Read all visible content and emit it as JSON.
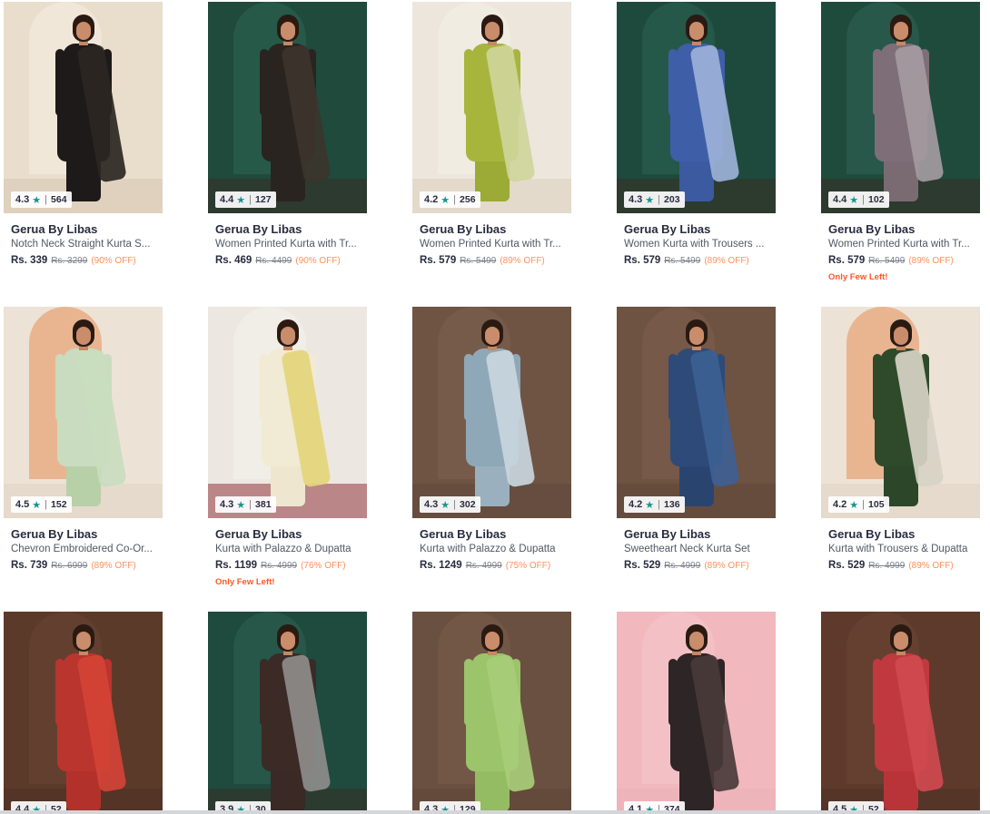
{
  "products": [
    {
      "brand": "Gerua By Libas",
      "title": "Notch Neck Straight Kurta S...",
      "price": "Rs. 339",
      "mrp": "Rs. 3299",
      "discount": "(90% OFF)",
      "rating": "4.3",
      "rating_count": "564",
      "few_left": "",
      "colors": {
        "bg": "#e9ddcc",
        "arch": "#f6efe3",
        "floor": "#d6c6ae",
        "outfit": "#1d1a19",
        "dupatta": "#2b2622",
        "legs": "#1d1a19"
      }
    },
    {
      "brand": "Gerua By Libas",
      "title": "Women Printed Kurta with Tr...",
      "price": "Rs. 469",
      "mrp": "Rs. 4499",
      "discount": "(90% OFF)",
      "rating": "4.4",
      "rating_count": "127",
      "few_left": "",
      "colors": {
        "bg": "#1f4a3c",
        "arch": "#2e6653",
        "floor": "#3a2a22",
        "outfit": "#2a2420",
        "dupatta": "#3c342c",
        "legs": "#2a2420"
      }
    },
    {
      "brand": "Gerua By Libas",
      "title": "Women Printed Kurta with Tr...",
      "price": "Rs. 579",
      "mrp": "Rs. 5499",
      "discount": "(89% OFF)",
      "rating": "4.2",
      "rating_count": "256",
      "few_left": "",
      "colors": {
        "bg": "#ece6dc",
        "arch": "#f4f0e8",
        "floor": "#d9cdb9",
        "outfit": "#a8b53c",
        "dupatta": "#cfd59a",
        "legs": "#9caa36"
      }
    },
    {
      "brand": "Gerua By Libas",
      "title": "Women Kurta with Trousers ...",
      "price": "Rs. 579",
      "mrp": "Rs. 5499",
      "discount": "(89% OFF)",
      "rating": "4.3",
      "rating_count": "203",
      "few_left": "",
      "colors": {
        "bg": "#1e4a3d",
        "arch": "#2c6452",
        "floor": "#3b2b22",
        "outfit": "#3f5ea8",
        "dupatta": "#9cb1d8",
        "legs": "#3b5aa0"
      }
    },
    {
      "brand": "Gerua By Libas",
      "title": "Women Printed Kurta with Tr...",
      "price": "Rs. 579",
      "mrp": "Rs. 5499",
      "discount": "(89% OFF)",
      "rating": "4.4",
      "rating_count": "102",
      "few_left": "Only Few Left!",
      "colors": {
        "bg": "#1f4b3d",
        "arch": "#2d6553",
        "floor": "#3a2a22",
        "outfit": "#7e6e78",
        "dupatta": "#a49aa0",
        "legs": "#7a6b72"
      }
    },
    {
      "brand": "Gerua By Libas",
      "title": "Chevron Embroidered Co-Or...",
      "price": "Rs. 739",
      "mrp": "Rs. 6999",
      "discount": "(89% OFF)",
      "rating": "4.5",
      "rating_count": "152",
      "few_left": "",
      "colors": {
        "bg": "#ece3d6",
        "arch": "#e7905a",
        "floor": "#ddd1bf",
        "outfit": "#c9dcbf",
        "dupatta": "#c9dcbf",
        "legs": "#b8d0a8"
      }
    },
    {
      "brand": "Gerua By Libas",
      "title": "Kurta with Palazzo & Dupatta",
      "price": "Rs. 1199",
      "mrp": "Rs. 4999",
      "discount": "(76% OFF)",
      "rating": "4.3",
      "rating_count": "381",
      "few_left": "Only Few Left!",
      "colors": {
        "bg": "#ece8e1",
        "arch": "#f5f2ec",
        "floor": "#8a2430",
        "outfit": "#f1ead4",
        "dupatta": "#e4d57a",
        "legs": "#efe6cf"
      }
    },
    {
      "brand": "Gerua By Libas",
      "title": "Kurta with Palazzo & Dupatta",
      "price": "Rs. 1249",
      "mrp": "Rs. 4999",
      "discount": "(75% OFF)",
      "rating": "4.3",
      "rating_count": "302",
      "few_left": "",
      "colors": {
        "bg": "#6f5444",
        "arch": "#7d6050",
        "floor": "#5e463a",
        "outfit": "#8fa8b8",
        "dupatta": "#c9d6de",
        "legs": "#9bb0be"
      }
    },
    {
      "brand": "Gerua By Libas",
      "title": "Sweetheart Neck Kurta Set",
      "price": "Rs. 529",
      "mrp": "Rs. 4999",
      "discount": "(89% OFF)",
      "rating": "4.2",
      "rating_count": "136",
      "few_left": "",
      "colors": {
        "bg": "#6e5242",
        "arch": "#7d5f4e",
        "floor": "#5d4538",
        "outfit": "#2e4a78",
        "dupatta": "#3d5f94",
        "legs": "#2a4470"
      }
    },
    {
      "brand": "Gerua By Libas",
      "title": "Kurta with Trousers & Dupatta",
      "price": "Rs. 529",
      "mrp": "Rs. 4999",
      "discount": "(89% OFF)",
      "rating": "4.2",
      "rating_count": "105",
      "few_left": "",
      "colors": {
        "bg": "#ece3d6",
        "arch": "#e7905a",
        "floor": "#ddd1bf",
        "outfit": "#2f4a2b",
        "dupatta": "#d8d2c6",
        "legs": "#2c4629"
      }
    },
    {
      "brand": "",
      "title": "",
      "price": "",
      "mrp": "",
      "discount": "",
      "rating": "4.4",
      "rating_count": "52",
      "few_left": "",
      "colors": {
        "bg": "#5c3a2a",
        "arch": "#6a4434",
        "floor": "#4a2e22",
        "outfit": "#b9352e",
        "dupatta": "#d24336",
        "legs": "#b2322b"
      }
    },
    {
      "brand": "",
      "title": "",
      "price": "",
      "mrp": "",
      "discount": "",
      "rating": "3.9",
      "rating_count": "30",
      "few_left": "",
      "colors": {
        "bg": "#1f4a3e",
        "arch": "#2b6252",
        "floor": "#3a2b22",
        "outfit": "#3b2a26",
        "dupatta": "#8e8c8a",
        "legs": "#3a2925"
      }
    },
    {
      "brand": "",
      "title": "",
      "price": "",
      "mrp": "",
      "discount": "",
      "rating": "4.3",
      "rating_count": "129",
      "few_left": "",
      "colors": {
        "bg": "#6a5040",
        "arch": "#785c4b",
        "floor": "#5b4336",
        "outfit": "#9cc46a",
        "dupatta": "#a8cc78",
        "legs": "#94bc62"
      }
    },
    {
      "brand": "",
      "title": "",
      "price": "",
      "mrp": "",
      "discount": "",
      "rating": "4.1",
      "rating_count": "374",
      "few_left": "",
      "colors": {
        "bg": "#f1b8be",
        "arch": "#f4c6ca",
        "floor": "#eab0b5",
        "outfit": "#2d2526",
        "dupatta": "#4a3a3a",
        "legs": "#2d2526"
      }
    },
    {
      "brand": "",
      "title": "",
      "price": "",
      "mrp": "",
      "discount": "",
      "rating": "4.5",
      "rating_count": "52",
      "few_left": "",
      "colors": {
        "bg": "#5e3a2c",
        "arch": "#6c4636",
        "floor": "#4c2f24",
        "outfit": "#c0393f",
        "dupatta": "#cf4a4f",
        "legs": "#b83439"
      }
    }
  ]
}
